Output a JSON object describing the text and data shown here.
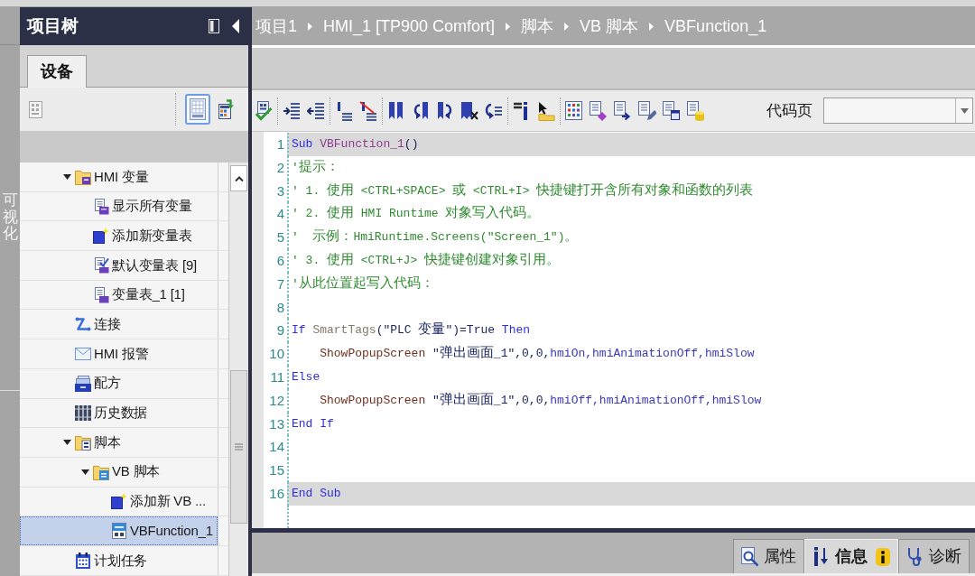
{
  "side_tab": {
    "label": "可视化"
  },
  "project_tree": {
    "title": "项目树",
    "tabs": [
      {
        "label": "设备",
        "selected": true
      }
    ],
    "view_buttons": [
      {
        "kind": "overview",
        "selected": true
      },
      {
        "kind": "update",
        "selected": false
      }
    ],
    "items": [
      {
        "label": "HMI 变量",
        "kind": "tag-folder",
        "selected": false,
        "expanded": true,
        "children": [
          {
            "label": "显示所有变量",
            "kind": "all-tags",
            "selected": false
          },
          {
            "label": "添加新变量表",
            "kind": "add-new",
            "selected": false
          },
          {
            "label": "默认变量表 [9]",
            "kind": "default-tag-table",
            "selected": false
          },
          {
            "label": "变量表_1 [1]",
            "kind": "tag-table",
            "selected": false
          }
        ]
      },
      {
        "label": "连接",
        "kind": "connections",
        "selected": false
      },
      {
        "label": "HMI 报警",
        "kind": "alarms",
        "selected": false
      },
      {
        "label": "配方",
        "kind": "recipes",
        "selected": false
      },
      {
        "label": "历史数据",
        "kind": "historical-data",
        "selected": false
      },
      {
        "label": "脚本",
        "kind": "script-folder",
        "selected": false,
        "expanded": true,
        "children": [
          {
            "label": "VB 脚本",
            "kind": "vb-folder",
            "selected": false,
            "expanded": true,
            "children": [
              {
                "label": "添加新 VB ...",
                "kind": "add-new",
                "selected": false
              },
              {
                "label": "VBFunction_1",
                "kind": "vb-script",
                "selected": true
              }
            ]
          }
        ]
      },
      {
        "label": "计划任务",
        "kind": "scheduler",
        "selected": false
      }
    ]
  },
  "breadcrumb": [
    "项目1",
    "HMI_1 [TP900 Comfort]",
    "脚本",
    "VB 脚本",
    "VBFunction_1"
  ],
  "toolbar": {
    "code_page": {
      "label": "代码页"
    }
  },
  "editor": {
    "lines": [
      {
        "number": "1",
        "highlighted": true,
        "tokens": [
          {
            "kind": "keyword",
            "text": "Sub"
          },
          {
            "kind": "procedure",
            "text": " VBFunction_1"
          },
          {
            "kind": "plain",
            "text": "()"
          }
        ]
      },
      {
        "number": "2",
        "highlighted": false,
        "tokens": [
          {
            "kind": "comment",
            "text": "'提示："
          }
        ]
      },
      {
        "number": "3",
        "highlighted": false,
        "tokens": [
          {
            "kind": "comment",
            "text": "' 1. 使用 <CTRL+SPACE> 或 <CTRL+I> 快捷键打开含所有对象和函数的列表"
          }
        ]
      },
      {
        "number": "4",
        "highlighted": false,
        "tokens": [
          {
            "kind": "comment",
            "text": "' 2. 使用 HMI Runtime 对象写入代码。"
          }
        ]
      },
      {
        "number": "5",
        "highlighted": false,
        "tokens": [
          {
            "kind": "comment",
            "text": "'  示例：HmiRuntime.Screens(\"Screen_1\")。"
          }
        ]
      },
      {
        "number": "6",
        "highlighted": false,
        "tokens": [
          {
            "kind": "comment",
            "text": "' 3. 使用 <CTRL+J> 快捷键创建对象引用。"
          }
        ]
      },
      {
        "number": "7",
        "highlighted": false,
        "tokens": [
          {
            "kind": "comment",
            "text": "'从此位置起写入代码："
          }
        ]
      },
      {
        "number": "8",
        "highlighted": false
      },
      {
        "number": "9",
        "highlighted": false,
        "tokens": [
          {
            "kind": "keyword",
            "text": "If"
          },
          {
            "kind": "object",
            "text": " SmartTags"
          },
          {
            "kind": "plain",
            "text": "(\"PLC 变量\")=True"
          },
          {
            "kind": "keyword",
            "text": " Then"
          }
        ]
      },
      {
        "number": "10",
        "highlighted": false,
        "tokens": [
          {
            "kind": "function",
            "text": "    ShowPopupScreen"
          },
          {
            "kind": "plain",
            "text": " \"弹出画面_1\",0,0,"
          },
          {
            "kind": "constant",
            "text": "hmiOn,hmiAnimationOff,hmiSlow"
          }
        ]
      },
      {
        "number": "11",
        "highlighted": false,
        "tokens": [
          {
            "kind": "keyword",
            "text": "Else"
          }
        ]
      },
      {
        "number": "12",
        "highlighted": false,
        "tokens": [
          {
            "kind": "function",
            "text": "    ShowPopupScreen"
          },
          {
            "kind": "plain",
            "text": " \"弹出画面_1\",0,0,"
          },
          {
            "kind": "constant",
            "text": "hmiOff,hmiAnimationOff,hmiSlow"
          }
        ]
      },
      {
        "number": "13",
        "highlighted": false,
        "tokens": [
          {
            "kind": "keyword",
            "text": "End If"
          }
        ]
      },
      {
        "number": "14",
        "highlighted": false
      },
      {
        "number": "15",
        "highlighted": false
      },
      {
        "number": "16",
        "highlighted": true,
        "tokens": [
          {
            "kind": "keyword",
            "text": "End Sub"
          }
        ]
      }
    ]
  },
  "bottom_tabs": [
    {
      "label": "属性",
      "kind": "properties",
      "selected": false,
      "notice": false
    },
    {
      "label": "信息",
      "kind": "info",
      "selected": true,
      "notice": true
    },
    {
      "label": "诊断",
      "kind": "diagnostics",
      "selected": false,
      "notice": false
    }
  ]
}
